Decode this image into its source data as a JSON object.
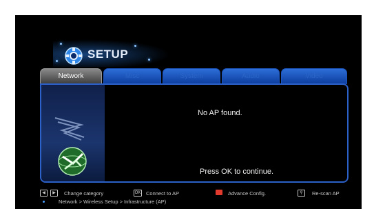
{
  "header": {
    "title": "SETUP",
    "icon": "gear-icon"
  },
  "tabs": [
    {
      "label": "Network",
      "active": true
    },
    {
      "label": "Misc",
      "active": false
    },
    {
      "label": "System",
      "active": false
    },
    {
      "label": "Audio",
      "active": false
    },
    {
      "label": "Video",
      "active": false
    }
  ],
  "panel": {
    "message": "No AP found.",
    "prompt": "Press OK to continue.",
    "side_icon": "network-globe-icon"
  },
  "footer": {
    "change_category": "Change category",
    "connect": "Connect to AP",
    "connect_key": "OK",
    "advance": "Advance Config.",
    "rescan": "Re-scan AP",
    "breadcrumb": "Network > Wireless Setup > Infrastructure (AP)"
  },
  "colors": {
    "accent": "#2c61c9",
    "active_tab": "#6f6f6f",
    "red_key": "#e23a2c"
  }
}
